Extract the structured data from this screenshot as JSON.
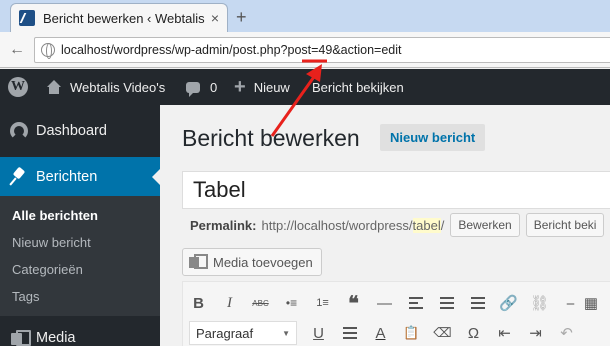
{
  "browser": {
    "tab_title": "Bericht bewerken ‹ Webtalis Vi…",
    "tab_close": "×",
    "new_tab": "+",
    "url": "localhost/wordpress/wp-admin/post.php?post=49&action=edit",
    "back": "←"
  },
  "adminbar": {
    "site_name": "Webtalis Video's",
    "comments_count": "0",
    "new_label": "Nieuw",
    "view_post": "Bericht bekijken"
  },
  "sidebar": {
    "dashboard": "Dashboard",
    "posts": "Berichten",
    "submenu": [
      "Alle berichten",
      "Nieuw bericht",
      "Categorieën",
      "Tags"
    ],
    "media": "Media"
  },
  "main": {
    "page_title": "Bericht bewerken",
    "add_new": "Nieuw bericht",
    "post_title": "Tabel",
    "permalink_label": "Permalink:",
    "permalink_base": "http://localhost/wordpress/",
    "permalink_slug": "tabel",
    "permalink_end": "/",
    "edit_btn": "Bewerken",
    "view_btn": "Bericht beki",
    "add_media": "Media toevoegen",
    "format_select": "Paragraaf",
    "format_arrow": "▼"
  },
  "editor_row1": [
    "B",
    "I",
    "ABC",
    "•≡",
    "1≡",
    "❝",
    "—",
    "≡L",
    "≡C",
    "≡R",
    "🔗",
    "⛓",
    "⎯",
    "▦"
  ],
  "editor_row2": [
    "U",
    "≡J",
    "A",
    "📋",
    "⌫",
    "Ω",
    "⇤",
    "⇥",
    "↶"
  ],
  "colors": {
    "adminbar": "#23282d",
    "accent": "#0073aa",
    "arrow": "#e8211c"
  }
}
